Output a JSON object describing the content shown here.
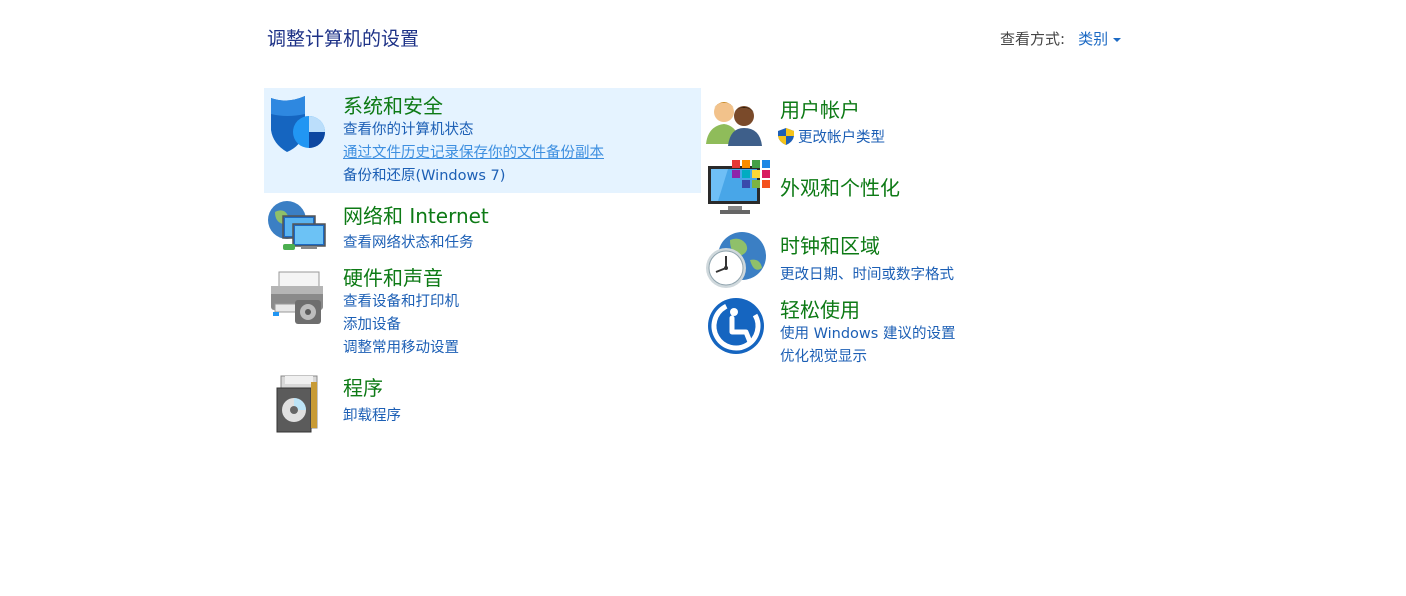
{
  "header": {
    "title": "调整计算机的设置",
    "view_by_label": "查看方式:",
    "view_by_value": "类别"
  },
  "categories": {
    "system": {
      "title": "系统和安全",
      "links": [
        "查看你的计算机状态",
        "通过文件历史记录保存你的文件备份副本",
        "备份和还原(Windows 7)"
      ]
    },
    "network": {
      "title": "网络和 Internet",
      "links": [
        "查看网络状态和任务"
      ]
    },
    "hardware": {
      "title": "硬件和声音",
      "links": [
        "查看设备和打印机",
        "添加设备",
        "调整常用移动设置"
      ]
    },
    "programs": {
      "title": "程序",
      "links": [
        "卸载程序"
      ]
    },
    "users": {
      "title": "用户帐户",
      "links": [
        "更改帐户类型"
      ]
    },
    "appearance": {
      "title": "外观和个性化",
      "links": []
    },
    "clock": {
      "title": "时钟和区域",
      "links": [
        "更改日期、时间或数字格式"
      ]
    },
    "ease": {
      "title": "轻松使用",
      "links": [
        "使用 Windows 建议的设置",
        "优化视觉显示"
      ]
    }
  },
  "colors": {
    "title_blue": "#1e3287",
    "category_green": "#0d7a15",
    "link_blue": "#1c5fb5",
    "highlight": "#e5f3ff"
  }
}
